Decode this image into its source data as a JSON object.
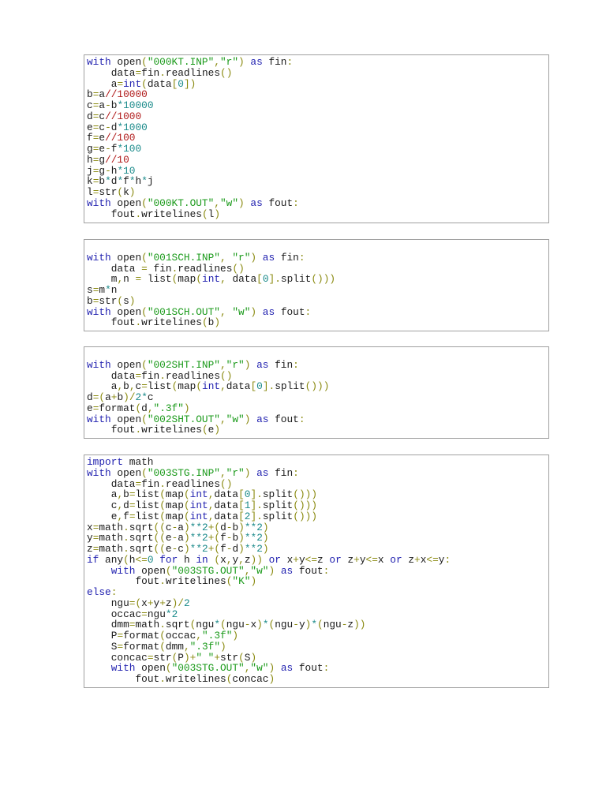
{
  "colors": {
    "keyword": "#2222b0",
    "string": "#1a9a1a",
    "number": "#1a8a8a",
    "floordiv": "#b01a1a",
    "operator": "#8a8a10"
  },
  "blocks": [
    {
      "lines": [
        "with open(\"000KT.INP\",\"r\") as fin:",
        "    data=fin.readlines()",
        "    a=int(data[0])",
        "b=a//10000",
        "c=a-b*10000",
        "d=c//1000",
        "e=c-d*1000",
        "f=e//100",
        "g=e-f*100",
        "h=g//10",
        "j=g-h*10",
        "k=b*d*f*h*j",
        "l=str(k)",
        "with open(\"000KT.OUT\",\"w\") as fout:",
        "    fout.writelines(l)"
      ]
    },
    {
      "lines": [
        "",
        "with open(\"001SCH.INP\", \"r\") as fin:",
        "    data = fin.readlines()",
        "    m,n = list(map(int, data[0].split()))",
        "s=m*n",
        "b=str(s)",
        "with open(\"001SCH.OUT\", \"w\") as fout:",
        "    fout.writelines(b)"
      ]
    },
    {
      "lines": [
        "",
        "with open(\"002SHT.INP\",\"r\") as fin:",
        "    data=fin.readlines()",
        "    a,b,c=list(map(int,data[0].split()))",
        "d=(a+b)/2*c",
        "e=format(d,\".3f\")",
        "with open(\"002SHT.OUT\",\"w\") as fout:",
        "    fout.writelines(e)"
      ]
    },
    {
      "lines": [
        "import math",
        "with open(\"003STG.INP\",\"r\") as fin:",
        "    data=fin.readlines()",
        "    a,b=list(map(int,data[0].split()))",
        "    c,d=list(map(int,data[1].split()))",
        "    e,f=list(map(int,data[2].split()))",
        "x=math.sqrt((c-a)**2+(d-b)**2)",
        "y=math.sqrt((e-a)**2+(f-b)**2)",
        "z=math.sqrt((e-c)**2+(f-d)**2)",
        "if any(h<=0 for h in (x,y,z)) or x+y<=z or z+y<=x or z+x<=y:",
        "    with open(\"003STG.OUT\",\"w\") as fout:",
        "        fout.writelines(\"K\")",
        "else:",
        "    ngu=(x+y+z)/2",
        "    occac=ngu*2",
        "    dmm=math.sqrt(ngu*(ngu-x)*(ngu-y)*(ngu-z))",
        "    P=format(occac,\".3f\")",
        "    S=format(dmm,\".3f\")",
        "    concac=str(P)+\" \"+str(S)",
        "    with open(\"003STG.OUT\",\"w\") as fout:",
        "        fout.writelines(concac)"
      ]
    }
  ]
}
